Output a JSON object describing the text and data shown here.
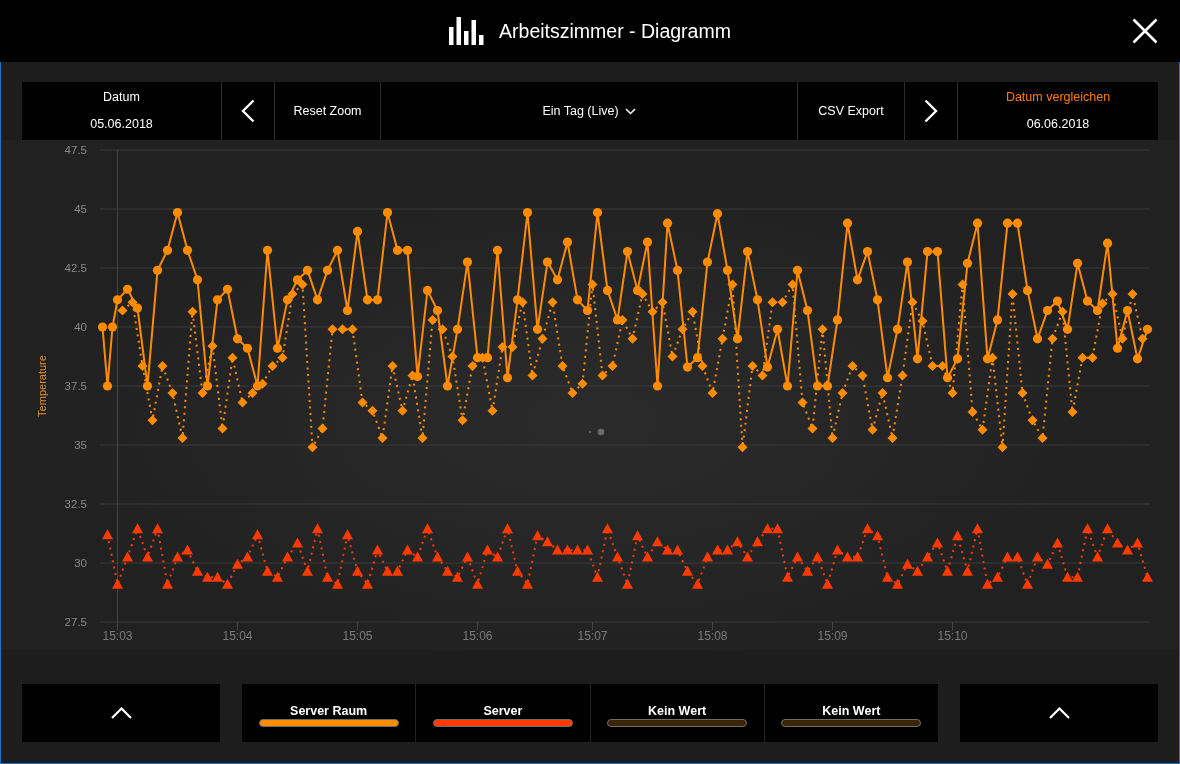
{
  "window": {
    "title": "Arbeitszimmer - Diagramm"
  },
  "toolbar": {
    "date": {
      "label": "Datum",
      "value": "05.06.2018"
    },
    "reset_zoom": "Reset Zoom",
    "range": {
      "value": "Ein Tag (Live)"
    },
    "csv_export": "CSV Export",
    "compare_date": {
      "label": "Datum vergleichen",
      "value": "06.06.2018"
    }
  },
  "chart": {
    "chart_data": {
      "type": "line",
      "ylabel": "Temperature",
      "grid": "y",
      "ylim": [
        27.5,
        47.5
      ],
      "yticks": [
        27.5,
        30,
        32.5,
        35,
        37.5,
        40,
        42.5,
        45,
        47.5
      ],
      "categories": [
        null,
        null,
        null,
        "15:03",
        null,
        null,
        null,
        null,
        null,
        null,
        null,
        null,
        null,
        null,
        null,
        null,
        null,
        null,
        null,
        null,
        null,
        null,
        null,
        null,
        null,
        null,
        null,
        "15:04",
        null,
        null,
        null,
        null,
        null,
        null,
        null,
        null,
        null,
        null,
        null,
        null,
        null,
        null,
        null,
        null,
        null,
        null,
        null,
        null,
        null,
        null,
        null,
        "15:05",
        null,
        null,
        null,
        null,
        null,
        null,
        null,
        null,
        null,
        null,
        null,
        null,
        null,
        null,
        null,
        null,
        null,
        null,
        null,
        null,
        null,
        null,
        null,
        "15:06",
        null,
        null,
        null,
        null,
        null,
        null,
        null,
        null,
        null,
        null,
        null,
        null,
        null,
        null,
        null,
        null,
        null,
        null,
        null,
        null,
        null,
        null,
        "15:07",
        null,
        null,
        null,
        null,
        null,
        null,
        null,
        null,
        null,
        null,
        null,
        null,
        null,
        null,
        null,
        null,
        null,
        null,
        null,
        null,
        null,
        null,
        null,
        "15:08",
        null,
        null,
        null,
        null,
        null,
        null,
        null,
        null,
        null,
        null,
        null,
        null,
        null,
        null,
        null,
        null,
        null,
        null,
        null,
        null,
        null,
        null,
        null,
        "15:09",
        null,
        null,
        null,
        null,
        null,
        null,
        null,
        null,
        null,
        null,
        null,
        null,
        null,
        null,
        null,
        null,
        null,
        null,
        null,
        null,
        null,
        null,
        null,
        "15:10",
        null,
        null,
        null,
        null,
        null,
        null,
        null,
        null,
        null,
        null,
        null,
        null,
        null,
        null,
        null,
        null,
        null,
        null,
        null,
        null,
        null,
        null,
        null,
        null,
        null,
        null,
        null,
        null,
        null,
        null,
        null,
        null,
        null,
        null,
        null,
        null,
        null,
        null,
        null
      ],
      "series": [
        {
          "color": "#ff8c00",
          "line_style": "solid",
          "marker": "circle",
          "values": [
            40,
            37.5,
            40,
            41.15,
            null,
            41.6,
            null,
            40.8,
            null,
            37.5,
            null,
            42.4,
            null,
            43.25,
            null,
            44.85,
            null,
            43.25,
            null,
            42,
            null,
            37.5,
            null,
            41.15,
            null,
            41.6,
            null,
            39.5,
            null,
            39.1,
            null,
            37.5,
            null,
            43.25,
            null,
            39.1,
            null,
            41.15,
            null,
            42,
            null,
            42.4,
            null,
            41.15,
            null,
            42.4,
            null,
            43.25,
            null,
            40.7,
            null,
            44.05,
            null,
            41.15,
            null,
            41.15,
            null,
            44.85,
            null,
            43.25,
            null,
            43.25,
            null,
            37.9,
            null,
            41.55,
            null,
            40.7,
            null,
            37.5,
            null,
            39.9,
            null,
            42.75,
            null,
            38.7,
            null,
            38.7,
            null,
            43.25,
            null,
            37.85,
            null,
            41.15,
            null,
            44.85,
            null,
            39.9,
            null,
            42.75,
            null,
            42,
            null,
            43.6,
            null,
            41.15,
            null,
            40.7,
            null,
            44.85,
            null,
            41.55,
            null,
            40.3,
            null,
            43.2,
            null,
            41.55,
            null,
            43.6,
            null,
            37.5,
            null,
            44.4,
            null,
            42.4,
            null,
            38.3,
            null,
            38.7,
            null,
            42.75,
            null,
            44.8,
            null,
            42.4,
            null,
            39.5,
            null,
            43.2,
            null,
            41.15,
            null,
            38.3,
            null,
            39.9,
            null,
            37.5,
            null,
            42.4,
            null,
            40.7,
            null,
            37.5,
            null,
            37.5,
            null,
            40.3,
            null,
            44.4,
            null,
            42,
            null,
            43.2,
            null,
            41.15,
            null,
            37.85,
            null,
            39.9,
            null,
            42.75,
            null,
            38.65,
            null,
            43.2,
            null,
            43.2,
            null,
            37.85,
            null,
            38.65,
            null,
            42.7,
            null,
            44.4,
            null,
            38.65,
            null,
            40.3,
            null,
            44.4,
            null,
            44.4,
            null,
            41.55,
            null,
            39.5,
            null,
            40.7,
            null,
            41.1,
            null,
            39.9,
            null,
            42.7,
            null,
            41.1,
            null,
            40.7,
            null,
            43.55,
            null,
            39.1,
            null,
            40.7,
            null,
            38.65,
            null,
            39.9
          ]
        },
        {
          "color": "#ff8c00",
          "line_style": "dotted",
          "marker": "diamond",
          "values": [
            null,
            null,
            null,
            null,
            40.7,
            null,
            41.05,
            null,
            38.35,
            null,
            36.05,
            null,
            38.35,
            null,
            37.2,
            null,
            35.3,
            null,
            40.65,
            null,
            37.2,
            null,
            39.2,
            null,
            35.7,
            null,
            38.7,
            null,
            36.8,
            null,
            37.2,
            null,
            37.6,
            null,
            38.35,
            null,
            38.7,
            null,
            41.4,
            null,
            41.8,
            null,
            34.9,
            null,
            35.7,
            null,
            39.9,
            null,
            39.9,
            null,
            39.9,
            null,
            36.8,
            null,
            36.45,
            null,
            35.3,
            null,
            38.35,
            null,
            36.45,
            null,
            37.95,
            null,
            35.3,
            null,
            40.3,
            null,
            39.9,
            null,
            38.75,
            null,
            36.05,
            null,
            38.35,
            null,
            38.7,
            null,
            36.45,
            null,
            39.15,
            null,
            39.15,
            null,
            41.05,
            null,
            37.95,
            null,
            39.5,
            null,
            41.05,
            null,
            38.35,
            null,
            37.2,
            null,
            37.6,
            null,
            41.8,
            null,
            37.95,
            null,
            38.35,
            null,
            40.3,
            null,
            39.5,
            null,
            41.4,
            null,
            40.65,
            null,
            41.05,
            null,
            38.75,
            null,
            39.9,
            null,
            40.65,
            null,
            38.35,
            null,
            37.2,
            null,
            39.5,
            null,
            41.8,
            null,
            34.9,
            null,
            38.35,
            null,
            37.95,
            null,
            41.05,
            null,
            41.05,
            null,
            41.8,
            null,
            36.8,
            null,
            35.7,
            null,
            39.9,
            null,
            35.3,
            null,
            37.2,
            null,
            38.35,
            null,
            37.95,
            null,
            35.65,
            null,
            37.2,
            null,
            35.3,
            null,
            37.95,
            null,
            41.05,
            null,
            40.25,
            null,
            38.35,
            null,
            38.35,
            null,
            37.2,
            null,
            41.8,
            null,
            36.4,
            null,
            35.65,
            null,
            38.7,
            null,
            34.9,
            null,
            41.4,
            null,
            37.2,
            null,
            36.05,
            null,
            35.3,
            null,
            39.5,
            null,
            40.65,
            null,
            36.4,
            null,
            38.7,
            null,
            38.7,
            null,
            41,
            null,
            41.4,
            null,
            39.5,
            null,
            41.4,
            null,
            39.5,
            null
          ]
        },
        {
          "color": "#ff3a00",
          "line_style": "dotted",
          "marker": "triangle",
          "values": [
            null,
            31.2,
            null,
            29.1,
            null,
            30.25,
            null,
            31.45,
            null,
            30.25,
            null,
            31.45,
            null,
            29.1,
            null,
            30.25,
            null,
            30.55,
            null,
            29.65,
            null,
            29.4,
            null,
            29.4,
            null,
            29.1,
            null,
            29.95,
            null,
            30.25,
            null,
            31.2,
            null,
            29.65,
            null,
            29.4,
            null,
            30.25,
            null,
            30.85,
            null,
            29.65,
            null,
            31.45,
            null,
            29.4,
            null,
            29.1,
            null,
            31.2,
            null,
            29.65,
            null,
            29.1,
            null,
            30.55,
            null,
            29.65,
            null,
            29.65,
            null,
            30.55,
            null,
            30.25,
            null,
            31.45,
            null,
            30.25,
            null,
            29.65,
            null,
            29.4,
            null,
            30.25,
            null,
            29.1,
            null,
            30.55,
            null,
            30.25,
            null,
            31.45,
            null,
            29.65,
            null,
            29.1,
            null,
            31.15,
            null,
            30.9,
            null,
            30.55,
            null,
            30.55,
            null,
            30.55,
            null,
            30.55,
            null,
            29.4,
            null,
            31.45,
            null,
            30.25,
            null,
            29.1,
            null,
            31.15,
            null,
            30.25,
            null,
            30.9,
            null,
            30.55,
            null,
            30.55,
            null,
            29.65,
            null,
            29.1,
            null,
            30.25,
            null,
            30.55,
            null,
            30.55,
            null,
            30.9,
            null,
            30.25,
            null,
            30.9,
            null,
            31.45,
            null,
            31.45,
            null,
            29.4,
            null,
            30.25,
            null,
            29.65,
            null,
            30.25,
            null,
            29.1,
            null,
            30.55,
            null,
            30.25,
            null,
            30.25,
            null,
            31.45,
            null,
            31.15,
            null,
            29.4,
            null,
            29.1,
            null,
            29.95,
            null,
            29.65,
            null,
            30.25,
            null,
            30.85,
            null,
            29.65,
            null,
            31.15,
            null,
            29.65,
            null,
            31.45,
            null,
            29.1,
            null,
            29.4,
            null,
            30.25,
            null,
            30.25,
            null,
            29.1,
            null,
            30.25,
            null,
            29.95,
            null,
            30.85,
            null,
            29.4,
            null,
            29.4,
            null,
            31.45,
            null,
            30.25,
            null,
            31.45,
            null,
            30.85,
            null,
            30.55,
            null,
            30.85,
            null,
            29.4
          ]
        }
      ]
    }
  },
  "legend": [
    {
      "label": "Server Raum",
      "color": "#ff8c00"
    },
    {
      "label": "Server",
      "color": "#ff3a00"
    },
    {
      "label": "Kein Wert",
      "color": "#3b2507"
    },
    {
      "label": "Kein Wert",
      "color": "#3b2507"
    }
  ]
}
